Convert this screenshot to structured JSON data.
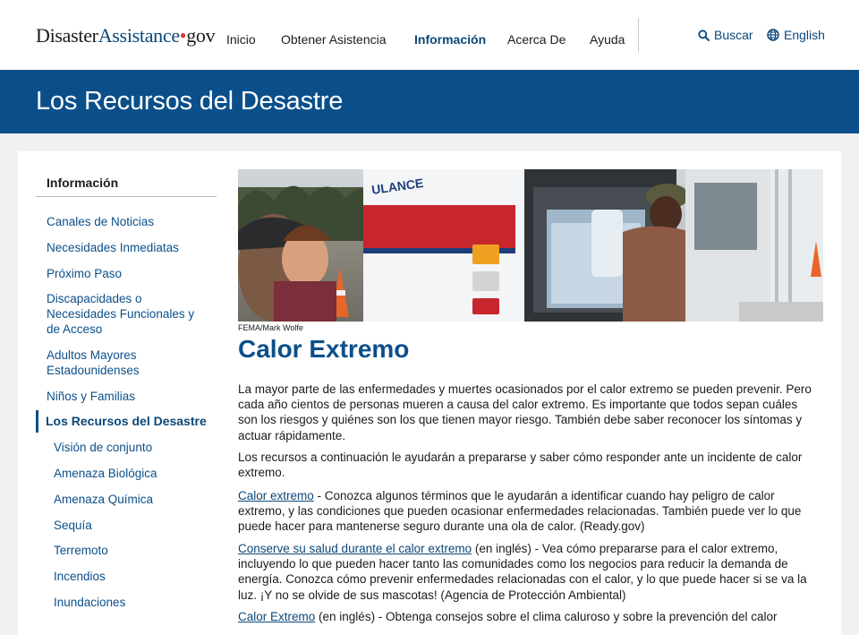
{
  "header": {
    "logo": {
      "part1": "Disaster",
      "part2": "Assistance",
      "dot": "•",
      "part3": "gov"
    },
    "nav": [
      "Inicio",
      "Obtener Asistencia",
      "Información",
      "Acerca De",
      "Ayuda"
    ],
    "active_nav": "Información",
    "search_label": "Buscar",
    "language_label": "English",
    "icons": {
      "search": "search-icon",
      "language": "globe-icon"
    }
  },
  "banner": {
    "title": "Los Recursos del Desastre"
  },
  "sidebar": {
    "heading": "Información",
    "items": [
      "Canales de Noticias",
      "Necesidades Inmediatas",
      "Próximo Paso",
      "Discapacidades o Necesidades Funcionales y de Acceso",
      "Adultos Mayores Estadounidenses",
      "Niños y Familias",
      "Los Recursos del Desastre",
      "Visión de conjunto",
      "Amenaza Biológica",
      "Amenaza Química",
      "Sequía",
      "Terremoto",
      "Incendios",
      "Inundaciones"
    ],
    "current": "Los Recursos del Desastre"
  },
  "article": {
    "photo_credit": "FEMA/Mark Wolfe",
    "title": "Calor Extremo",
    "intro1": "La mayor parte de las enfermedades y muertes ocasionados por el calor extremo se pueden prevenir. Pero cada año cientos de personas mueren a causa del calor extremo. Es importante que todos sepan cuáles son los riesgos y quiénes son los que tienen mayor riesgo. También debe saber reconocer los síntomas y actuar rápidamente.",
    "intro2": "Los recursos a continuación le ayudarán a prepararse y saber cómo responder ante un incidente de calor extremo.",
    "resources": [
      {
        "link": "Calor extremo",
        "text": " - Conozca algunos términos que le ayudarán a identificar cuando hay peligro de calor extremo, y las condiciones que pueden ocasionar enfermedades relacionadas. También puede ver lo que puede hacer para mantenerse seguro durante una ola de calor. (Ready.gov)"
      },
      {
        "link": "Conserve su salud durante el calor extremo",
        "text": " (en inglés) - Vea cómo prepararse para el calor extremo, incluyendo lo que pueden hacer tanto las comunidades como los negocios para reducir la demanda de energía. Conozca cómo prevenir enfermedades relacionadas con el calor, y lo que puede hacer si se va la luz. ¡Y no se olvide de sus mascotas! (Agencia de Protección Ambiental)"
      },
      {
        "link": "Calor Extremo",
        "text": " (en inglés) - Obtenga consejos sobre el clima caluroso y sobre la prevención del calor"
      }
    ]
  },
  "colors": {
    "brand_blue": "#0b4f8a",
    "link_blue": "#0b4778",
    "logo_dot": "#d83933"
  }
}
